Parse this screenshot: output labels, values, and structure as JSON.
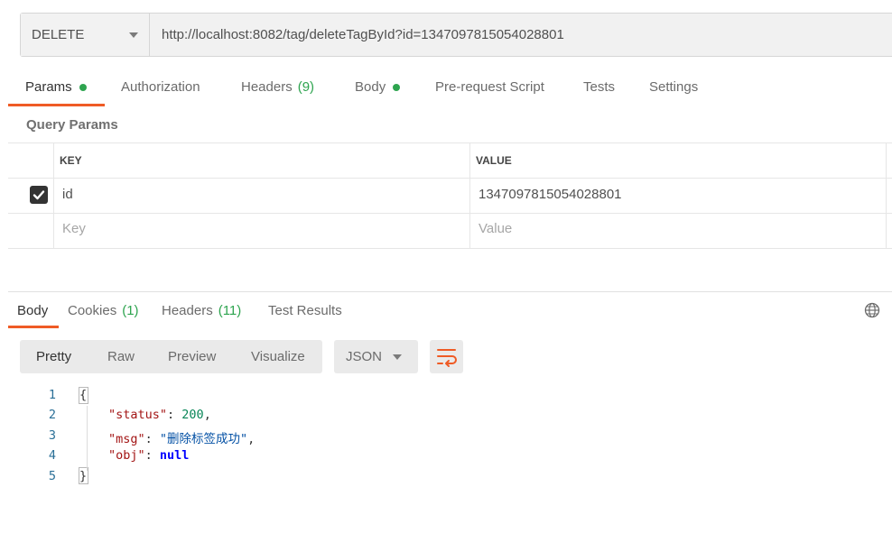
{
  "request": {
    "method": "DELETE",
    "url": "http://localhost:8082/tag/deleteTagById?id=1347097815054028801"
  },
  "request_tabs": [
    {
      "label": "Params",
      "dot": true
    },
    {
      "label": "Authorization"
    },
    {
      "label": "Headers",
      "count": "(9)"
    },
    {
      "label": "Body",
      "dot": true
    },
    {
      "label": "Pre-request Script"
    },
    {
      "label": "Tests"
    },
    {
      "label": "Settings"
    }
  ],
  "query_params": {
    "title": "Query Params",
    "headers": [
      "KEY",
      "VALUE"
    ],
    "rows": [
      {
        "checked": true,
        "key": "id",
        "value": "1347097815054028801"
      }
    ],
    "new_row": {
      "key_placeholder": "Key",
      "value_placeholder": "Value"
    }
  },
  "response_tabs": [
    {
      "label": "Body"
    },
    {
      "label": "Cookies",
      "count": "(1)"
    },
    {
      "label": "Headers",
      "count": "(11)"
    },
    {
      "label": "Test Results"
    }
  ],
  "view_modes": [
    "Pretty",
    "Raw",
    "Preview",
    "Visualize"
  ],
  "format": "JSON",
  "code": {
    "line_numbers": [
      "1",
      "2",
      "3",
      "4",
      "5"
    ],
    "open_brace": "{",
    "close_brace": "}",
    "status_key": "\"status\"",
    "status_value": "200",
    "msg_key": "\"msg\"",
    "msg_value": "\"删除标签成功\"",
    "obj_key": "\"obj\"",
    "obj_value": "null"
  },
  "colors": {
    "accent": "#ef5b25",
    "status_green": "#2ea44f"
  },
  "icons": [
    "chevron-down-icon",
    "checkbox-checked-icon",
    "globe-icon",
    "wrap-lines-icon"
  ]
}
